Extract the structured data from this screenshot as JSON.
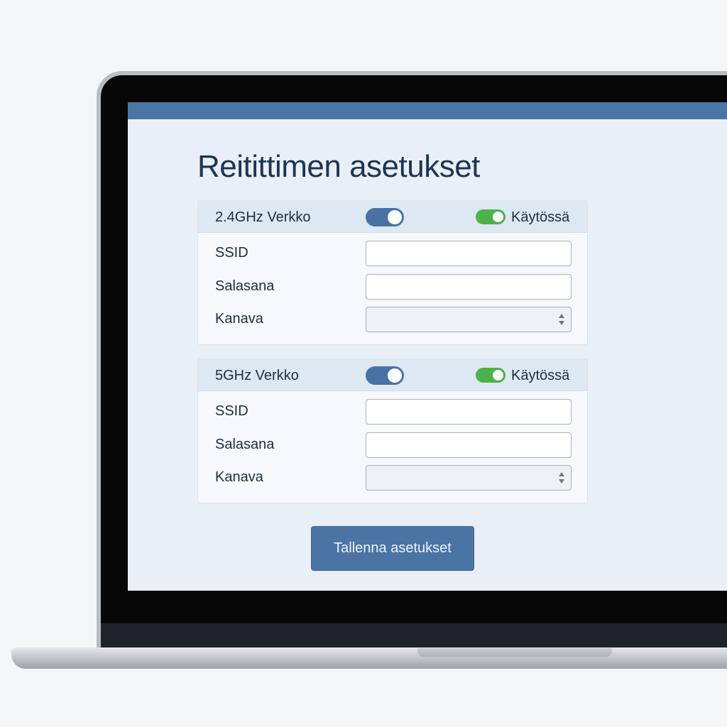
{
  "page": {
    "title": "Reitittimen asetukset"
  },
  "networks": [
    {
      "title": "2.4GHz Verkko",
      "status_label": "Käytössä",
      "fields": {
        "ssid": "SSID",
        "password": "Salasana",
        "channel": "Kanava"
      }
    },
    {
      "title": "5GHz Verkko",
      "status_label": "Käytössä",
      "fields": {
        "ssid": "SSID",
        "password": "Salasana",
        "channel": "Kanava"
      }
    }
  ],
  "actions": {
    "save_label": "Tallenna asetukset"
  },
  "colors": {
    "accent": "#4a76a6",
    "toggle_on_green": "#4cb24a",
    "title_text": "#1d3552",
    "screen_bg": "#e9eff6"
  },
  "icons": {
    "network_toggle": "toggle-switch",
    "enabled_toggle": "toggle-switch",
    "select_arrows": "up-down-arrows-icon"
  }
}
